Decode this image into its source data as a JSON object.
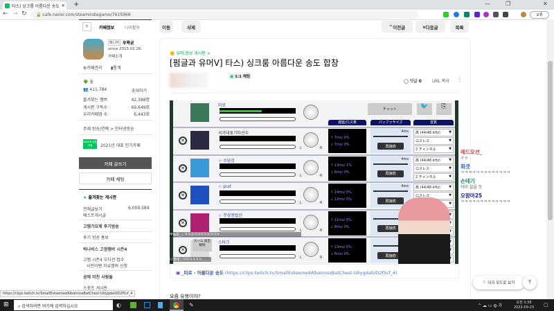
{
  "browser": {
    "tab_title": "타스) 싱크룸 아름다운 송도",
    "url": "cafe.naver.com/steamindiegame/7615966",
    "profile_label": "오류"
  },
  "sidebar": {
    "tabs": [
      "카페정보",
      "나의활동"
    ],
    "manager_badge": "매니저",
    "manager_name": "우왁굳",
    "since": "since 2015.02.26.",
    "cafe_intro": "카페소개",
    "manage": "카페관리",
    "stats": "통계",
    "level": "숲",
    "members": "411,784",
    "invite": "초대하기",
    "info": [
      {
        "label": "즐겨찾는 멤버",
        "value": "42,388명"
      },
      {
        "label": "게시판 구독수",
        "value": "69,649회"
      },
      {
        "label": "우리카페앱 수",
        "value": "6,443회"
      }
    ],
    "topic": "주제  방송/연예 > 인터넷방송",
    "award_badge": "NAVER 대표카페",
    "award": "2021년 대표 인기카페",
    "write": "카페 글쓰기",
    "chat": "카페 채팅",
    "fav_boards": "즐겨찾는 게시판",
    "boards": [
      {
        "label": "전체글보기",
        "count": "6,009,584"
      },
      {
        "label": "베스트게시글"
      }
    ],
    "sections": [
      {
        "title": "고멤가요제 후기방송",
        "items": [
          "후기 방송 홍보"
        ]
      },
      {
        "title": "빅나비스 고정멤버 시즌4",
        "items": [
          "고멤 시즌4 오디션 접수",
          "사전이벤 자유멤버 신청"
        ]
      },
      {
        "title": "공에 미친 사람들",
        "items": [
          "스포츠 게시판"
        ]
      }
    ]
  },
  "toolbar": {
    "move": "이동",
    "delete": "삭제",
    "prev": "이전글",
    "next": "다음글",
    "list": "목록"
  },
  "article": {
    "board": "유머,정보 게시판 >",
    "title": "[펌글과 유머ᐯ] 타스) 싱크룸 아름다운 송도 합창",
    "chat_1on1": "1:1 채팅",
    "comments_label": "댓글",
    "comments_count": "0",
    "url_copy": "URL 복사",
    "link_title": "_미로 - 아름다운 송도",
    "link_url": "(https://clips.twitch.tv/SmallEsteemedAlbatrossBatChest-U0ygdalUD2f5cf_4)",
    "body": "요즘 유행이야?"
  },
  "video": {
    "top_name": "미로",
    "chat_btn": "チャット",
    "headers": [
      "遅延/ロス率",
      "バッファサイズ",
      "音質"
    ],
    "rows": [
      {
        "name": "국가대표기타선수",
        "up": "7ms/",
        "upl": "0%",
        "dn": "7ms/",
        "dnl": "0%"
      },
      {
        "name": "☆ 수담강",
        "up": "13ms/",
        "upl": "1%",
        "dn": "8ms/",
        "dnl": "0%"
      },
      {
        "name": "☆ pud",
        "up": "14ms/",
        "upl": "0%",
        "dn": "12ms/",
        "dnl": "0%"
      },
      {
        "name": "☆ 무상정법신",
        "up": "11ms/",
        "upl": "0%",
        "dn": "8ms/",
        "dnl": "0%"
      },
      {
        "name": "스타크",
        "up": "23ms/",
        "upl": "0%",
        "dn": "8ms/",
        "dnl": "0%"
      }
    ],
    "buf": "4ms",
    "play": "再接続",
    "quality": [
      "高 (44/48 kHz)",
      "ロスレス",
      "2 チャンネル"
    ],
    "room_btn": "ルーム 退出解除",
    "stream_chat": [
      "부농돈_ : ㅋㅋㅋㅋㅋㅋㅋㅋㅋㅋㅋ",
      "나델에 : ㅋㅋㅋㅋㅋㅋ"
    ]
  },
  "chat_overlay": [
    {
      "name": "레드오션_",
      "msg": "ㅎㅎ",
      "color": "#e0303a"
    },
    {
      "name": "회갯",
      "msg": "ㅋㅋㅋㅋㅋㅋㅋㅋㅋㅋㅋㅋㅋ",
      "color": "#1f5fbf"
    },
    {
      "name": "손테기",
      "msg": "의미 없을 듯",
      "color": "#2a7a6a"
    },
    {
      "name": "오함마25",
      "msg": "ㅋㅋㅋㅋㅋㅋㅋㅋㅋㅋㅋㅋㅋ",
      "color": "#1a1aa0"
    }
  ],
  "floating": {
    "dark_mode": "다크 모드로 보기"
  },
  "status_url": "https://clips.twitch.tv/SmallEsteemedAlbatrossBatChest-U0ygdalUD2f5cf_4",
  "taskbar": {
    "search": "검색하려면 여기에 입력하십시오",
    "time": "오전 3:38",
    "date": "2022-09-23"
  }
}
